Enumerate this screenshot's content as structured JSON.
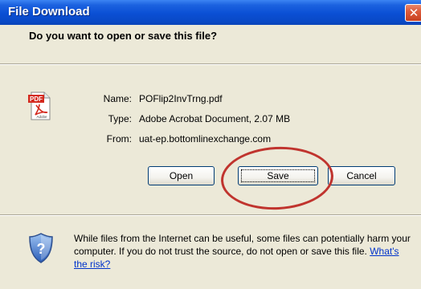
{
  "window": {
    "title": "File Download",
    "close_glyph": "✕"
  },
  "dialog": {
    "question": "Do you want to open or save this file?",
    "file_icon": "pdf-icon",
    "pdf_badge": "PDF",
    "adobe_text": "Adobe",
    "name_label": "Name:",
    "name_value": "POFlip2InvTrng.pdf",
    "type_label": "Type:",
    "type_value": "Adobe Acrobat Document, 2.07 MB",
    "from_label": "From:",
    "from_value": "uat-ep.bottomlinexchange.com"
  },
  "buttons": {
    "open_label": "Open",
    "save_label": "Save",
    "cancel_label": "Cancel"
  },
  "warning": {
    "icon": "shield-icon",
    "text": "While files from the Internet can be useful, some files can potentially harm your computer. If you do not trust the source, do not open or save this file. ",
    "link_text": "What's the risk?"
  },
  "colors": {
    "title_bar": "#0a4fd4",
    "dialog_bg": "#ece9d8",
    "highlight_circle": "#c0342e",
    "link": "#0033cc"
  }
}
